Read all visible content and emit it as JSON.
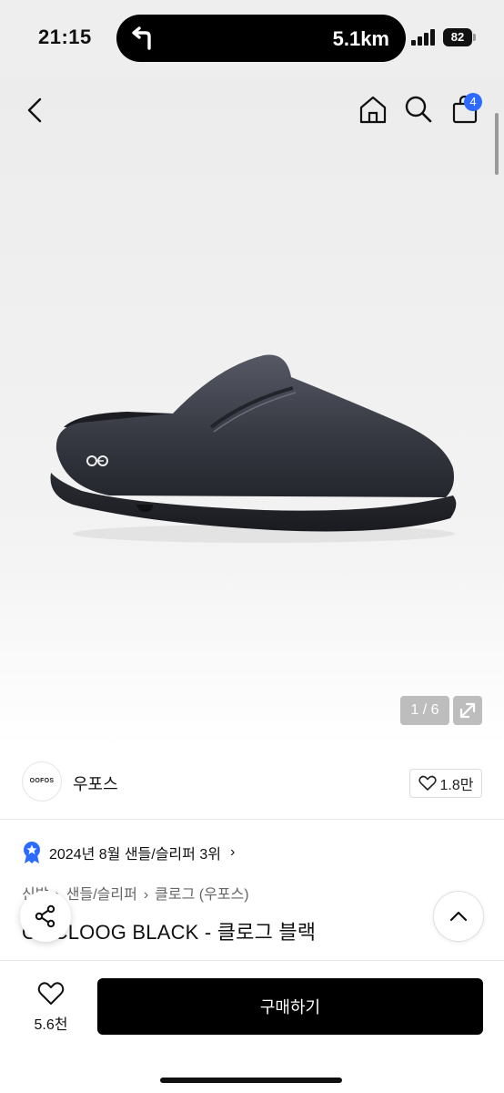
{
  "status_bar": {
    "time": "21:15",
    "navigation_distance": "5.1km",
    "battery_level": "82",
    "icons": [
      "turn-left-arrow-icon",
      "signal-bars-icon",
      "battery-icon"
    ]
  },
  "header": {
    "icons": [
      "back-chevron-icon",
      "home-icon",
      "search-icon",
      "shopping-bag-icon"
    ],
    "cart_badge": "4"
  },
  "gallery": {
    "counter": "1 / 6",
    "expand_icon": "expand-arrows-icon"
  },
  "brand": {
    "logo_text": "OOFOS",
    "name": "우포스",
    "likes": "1.8만",
    "like_icon": "heart-outline-icon"
  },
  "ranking": {
    "icon": "star-badge-icon",
    "text": "2024년 8월 샌들/슬리퍼 3위",
    "chevron": "›"
  },
  "breadcrumb": [
    "신발",
    "샌들/슬리퍼",
    "클로그 (우포스)"
  ],
  "product": {
    "title": "OOCLOOG BLACK - 클로그 블랙"
  },
  "floating": {
    "share_icon": "share-icon",
    "top_icon": "chevron-up-icon"
  },
  "bottom_bar": {
    "wish_count": "5.6천",
    "buy_label": "구매하기"
  },
  "colors": {
    "accent": "#2d6bff",
    "buy_button": "#000000",
    "hero_bg": "#ececec"
  }
}
